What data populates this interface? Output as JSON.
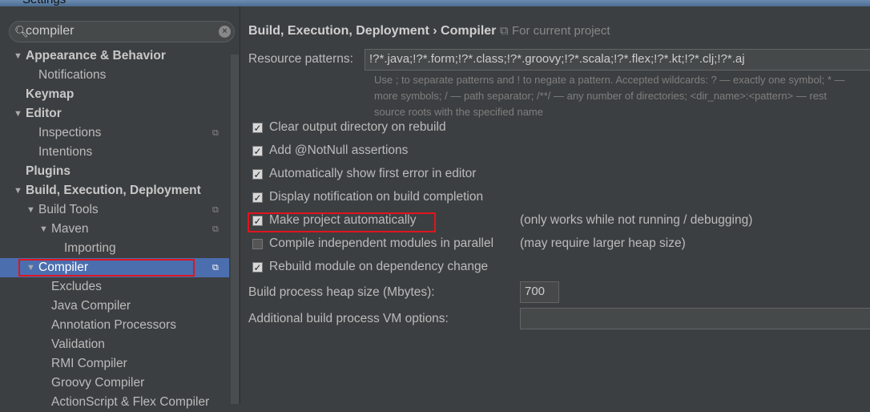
{
  "window": {
    "title": "Settings"
  },
  "search": {
    "value": "compiler"
  },
  "tree": [
    {
      "label": "Appearance & Behavior",
      "level": 0,
      "bold": true,
      "arrow": "down"
    },
    {
      "label": "Notifications",
      "level": 1
    },
    {
      "label": "Keymap",
      "level": 0,
      "bold": true
    },
    {
      "label": "Editor",
      "level": 0,
      "bold": true,
      "arrow": "down"
    },
    {
      "label": "Inspections",
      "level": 1,
      "copy": true
    },
    {
      "label": "Intentions",
      "level": 1
    },
    {
      "label": "Plugins",
      "level": 0,
      "bold": true
    },
    {
      "label": "Build, Execution, Deployment",
      "level": 0,
      "bold": true,
      "arrow": "down"
    },
    {
      "label": "Build Tools",
      "level": 1,
      "arrow": "down",
      "copy": true
    },
    {
      "label": "Maven",
      "level": 2,
      "arrow": "down",
      "copy": true
    },
    {
      "label": "Importing",
      "level": 3
    },
    {
      "label": "Compiler",
      "level": 1,
      "arrow": "down",
      "copy": true,
      "selected": true
    },
    {
      "label": "Excludes",
      "level": 2
    },
    {
      "label": "Java Compiler",
      "level": 2
    },
    {
      "label": "Annotation Processors",
      "level": 2
    },
    {
      "label": "Validation",
      "level": 2
    },
    {
      "label": "RMI Compiler",
      "level": 2
    },
    {
      "label": "Groovy Compiler",
      "level": 2
    },
    {
      "label": "ActionScript & Flex Compiler",
      "level": 2
    }
  ],
  "breadcrumb": {
    "path": "Build, Execution, Deployment",
    "sep": "›",
    "current": "Compiler",
    "scope": "For current project"
  },
  "resource": {
    "label": "Resource patterns:",
    "value": "!?*.java;!?*.form;!?*.class;!?*.groovy;!?*.scala;!?*.flex;!?*.kt;!?*.clj;!?*.aj",
    "hint": [
      "Use ; to separate patterns and ! to negate a pattern. Accepted wildcards: ? — exactly one symbol; * —",
      "more symbols; / — path separator; /**/ — any number of directories; <dir_name>:<pattern> — rest",
      "source roots with the specified name"
    ]
  },
  "options": [
    {
      "label": "Clear output directory on rebuild",
      "checked": true
    },
    {
      "label": "Add @NotNull assertions",
      "checked": true
    },
    {
      "label": "Automatically show first error in editor",
      "checked": true
    },
    {
      "label": "Display notification on build completion",
      "checked": true
    },
    {
      "label": "Make project automatically",
      "checked": true,
      "note": "(only works while not running / debugging)",
      "highlighted": true
    },
    {
      "label": "Compile independent modules in parallel",
      "checked": false,
      "note": "(may require larger heap size)"
    },
    {
      "label": "Rebuild module on dependency change",
      "checked": true
    }
  ],
  "heap": {
    "label": "Build process heap size (Mbytes):",
    "value": "700"
  },
  "vm": {
    "label": "Additional build process VM options:",
    "value": ""
  },
  "colors": {
    "selection": "#4b6eaf",
    "highlight": "#e0141e",
    "background": "#3c3f41"
  }
}
